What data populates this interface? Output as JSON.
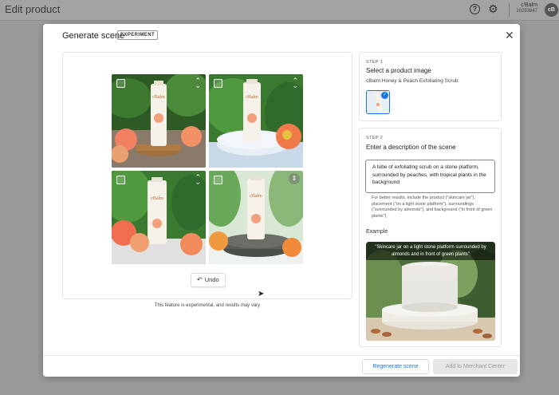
{
  "app": {
    "title": "Edit product",
    "account_name": "c'Balm",
    "account_id": "10293847",
    "avatar_initials": "cB"
  },
  "modal": {
    "title": "Generate scene",
    "badge": "EXPERIMENT"
  },
  "scenes": {
    "undo_label": "Undo",
    "disclaimer": "This feature is experimental, and results may vary",
    "tiles": [
      {
        "checked": false
      },
      {
        "checked": false
      },
      {
        "checked": false
      },
      {
        "checked": false
      }
    ]
  },
  "step1": {
    "step_label": "STEP 1",
    "title": "Select a product image",
    "product_name": "cBalm Honey & Peach Exfoliating Scrub"
  },
  "step2": {
    "step_label": "STEP 2",
    "title": "Enter a description of the scene",
    "description": "A tube of exfoliating scrub on a stone platform, surrounded by peaches, with tropical plants in the background",
    "hint": "For better results, include the product (\"skincare jar\"), placement (\"on a light stone platform\"), surroundings (\"surrounded by almonds\"), and background (\"in front of green plants\")",
    "example_label": "Example",
    "example_caption": "\"Skincare jar on a light stone platform surrounded by almonds and in front of green plants\""
  },
  "footer": {
    "regenerate_label": "Regenerate scene",
    "add_label": "Add to Merchant Center"
  },
  "colors": {
    "accent": "#1a73e8",
    "leaf": "#2f6b2a",
    "peach": "#f0a07a"
  }
}
